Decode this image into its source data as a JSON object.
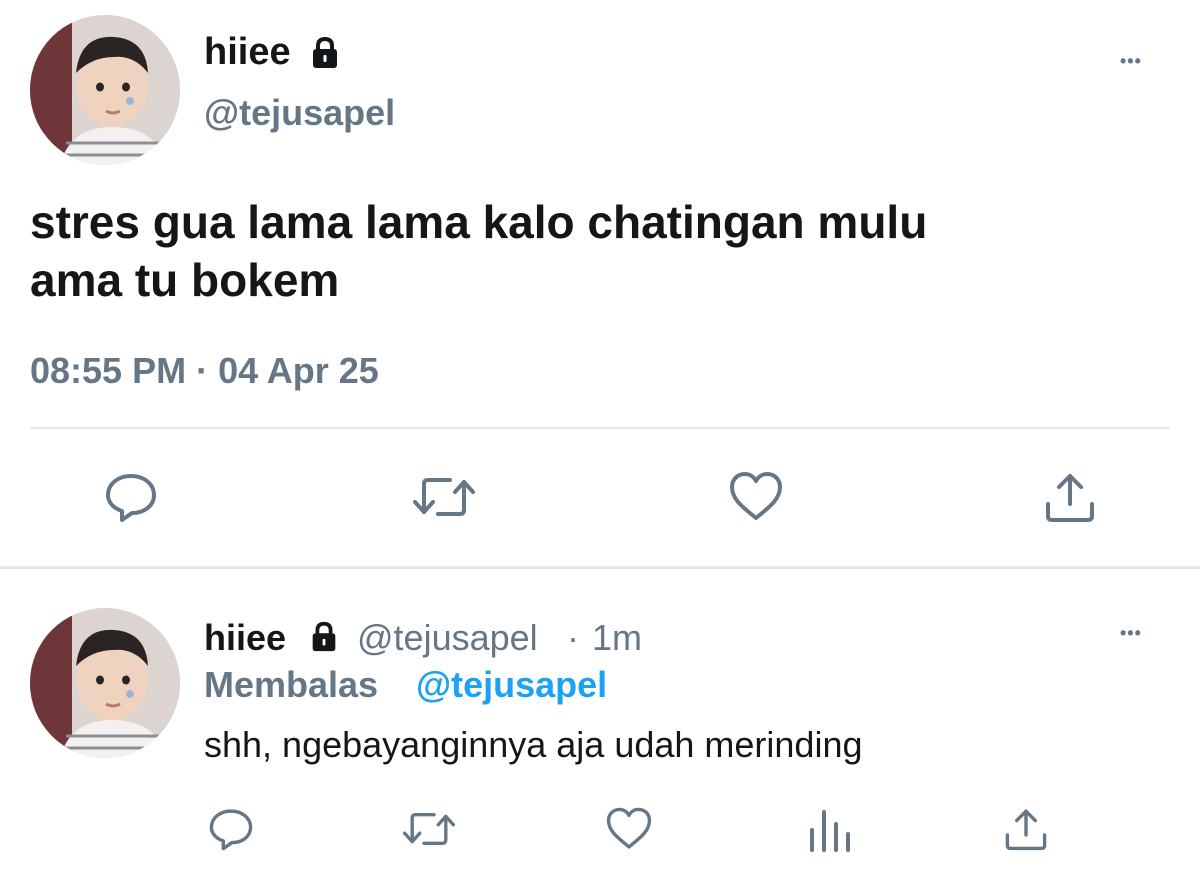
{
  "main_tweet": {
    "display_name": "hiiee",
    "handle": "@tejusapel",
    "text_line1": "stres gua lama lama kalo chatingan mulu",
    "text_line2": "ama tu bokem",
    "timestamp": "08:55 PM · 04 Apr 25",
    "more_label": "•••",
    "actions": [
      "reply-icon",
      "retweet-icon",
      "like-icon",
      "share-icon"
    ]
  },
  "reply_tweet": {
    "display_name": "hiiee",
    "handle": "@tejusapel",
    "separator": "·",
    "time_ago": "1m",
    "replying_label": "Membalas",
    "replying_to": "@tejusapel",
    "text": "shh, ngebayanginnya aja udah merinding",
    "more_label": "•••",
    "actions": [
      "reply-icon",
      "retweet-icon",
      "like-icon",
      "analytics-icon",
      "share-icon"
    ]
  },
  "colors": {
    "text": "#14171a",
    "muted": "#657786",
    "link": "#1da1f2",
    "divider": "#e1e8ed"
  }
}
